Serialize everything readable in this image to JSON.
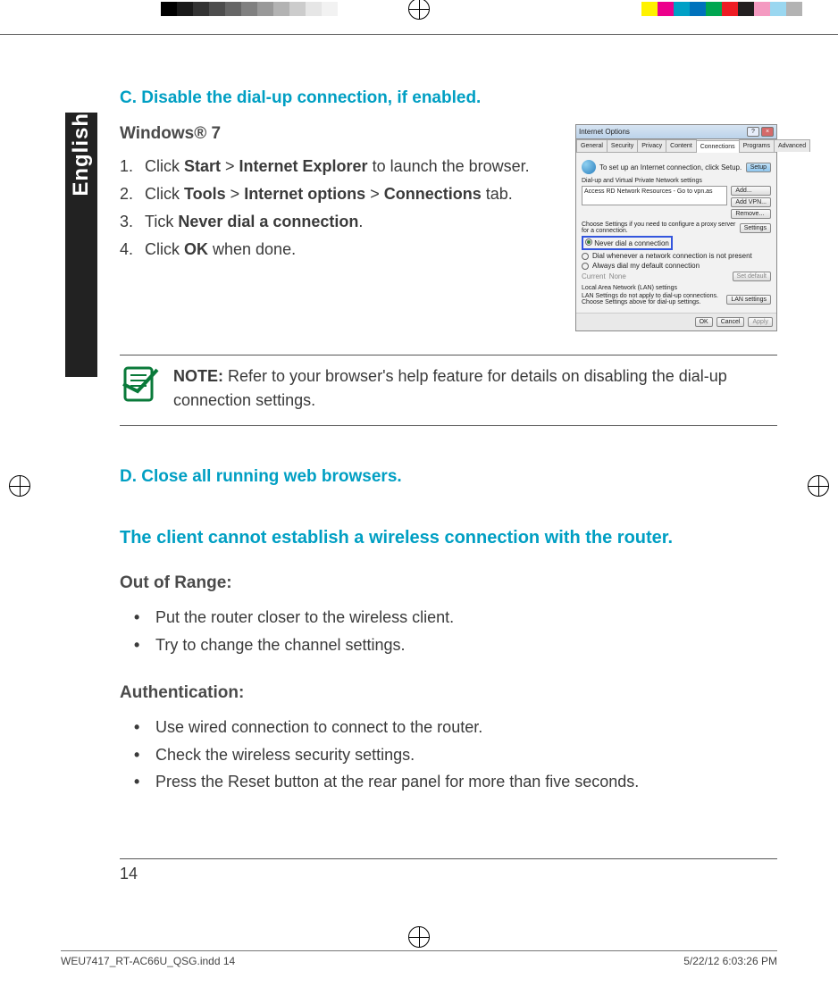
{
  "language_tab": "English",
  "section_c": {
    "heading": "C.   Disable the dial-up connection, if enabled.",
    "os": "Windows® 7",
    "steps": [
      {
        "pre": "Click ",
        "b1": "Start",
        "mid1": " > ",
        "b2": "Internet Explorer",
        "post": " to launch the browser."
      },
      {
        "pre": "Click ",
        "b1": "Tools",
        "mid1": " > ",
        "b2": "Internet options",
        "mid2": " > ",
        "b3": "Connections",
        "post": " tab."
      },
      {
        "pre": "Tick ",
        "b1": "Never dial a connection",
        "post": "."
      },
      {
        "pre": "Click ",
        "b1": "OK",
        "post": " when done."
      }
    ]
  },
  "dialog": {
    "title": "Internet Options",
    "tabs": [
      "General",
      "Security",
      "Privacy",
      "Content",
      "Connections",
      "Programs",
      "Advanced"
    ],
    "setup_line": "To set up an Internet connection, click Setup.",
    "setup_btn": "Setup",
    "dial_header": "Dial-up and Virtual Private Network settings",
    "list_item": "Access RD Network Resources - Go to vpn.as",
    "btn_add": "Add...",
    "btn_addvpn": "Add VPN...",
    "btn_remove": "Remove...",
    "proxy_line": "Choose Settings if you need to configure a proxy server for a connection.",
    "btn_settings": "Settings",
    "opt_never": "Never dial a connection",
    "opt_dialwhen": "Dial whenever a network connection is not present",
    "opt_always": "Always dial my default connection",
    "current_lbl": "Current",
    "current_val": "None",
    "btn_setdef": "Set default",
    "lan_header": "Local Area Network (LAN) settings",
    "lan_line": "LAN Settings do not apply to dial-up connections. Choose Settings above for dial-up settings.",
    "btn_lan": "LAN settings",
    "btn_ok": "OK",
    "btn_cancel": "Cancel",
    "btn_apply": "Apply"
  },
  "note": {
    "label": "NOTE:",
    "text": "   Refer to your browser's help feature for details on disabling the dial-up connection settings."
  },
  "section_d": {
    "heading": "D.   Close all running web browsers."
  },
  "wireless": {
    "heading": "The client cannot establish a wireless connection with the router.",
    "range_heading": "Out of Range:",
    "range_items": [
      "Put the router closer to the wireless client.",
      "Try to change the channel settings."
    ],
    "auth_heading": "Authentication:",
    "auth_items": [
      "Use wired connection to connect to the router.",
      "Check the wireless security settings.",
      "Press the Reset button at the rear panel for more than five seconds."
    ]
  },
  "page_number": "14",
  "slug": {
    "file": "WEU7417_RT-AC66U_QSG.indd   14",
    "date": "5/22/12   6:03:26 PM"
  }
}
